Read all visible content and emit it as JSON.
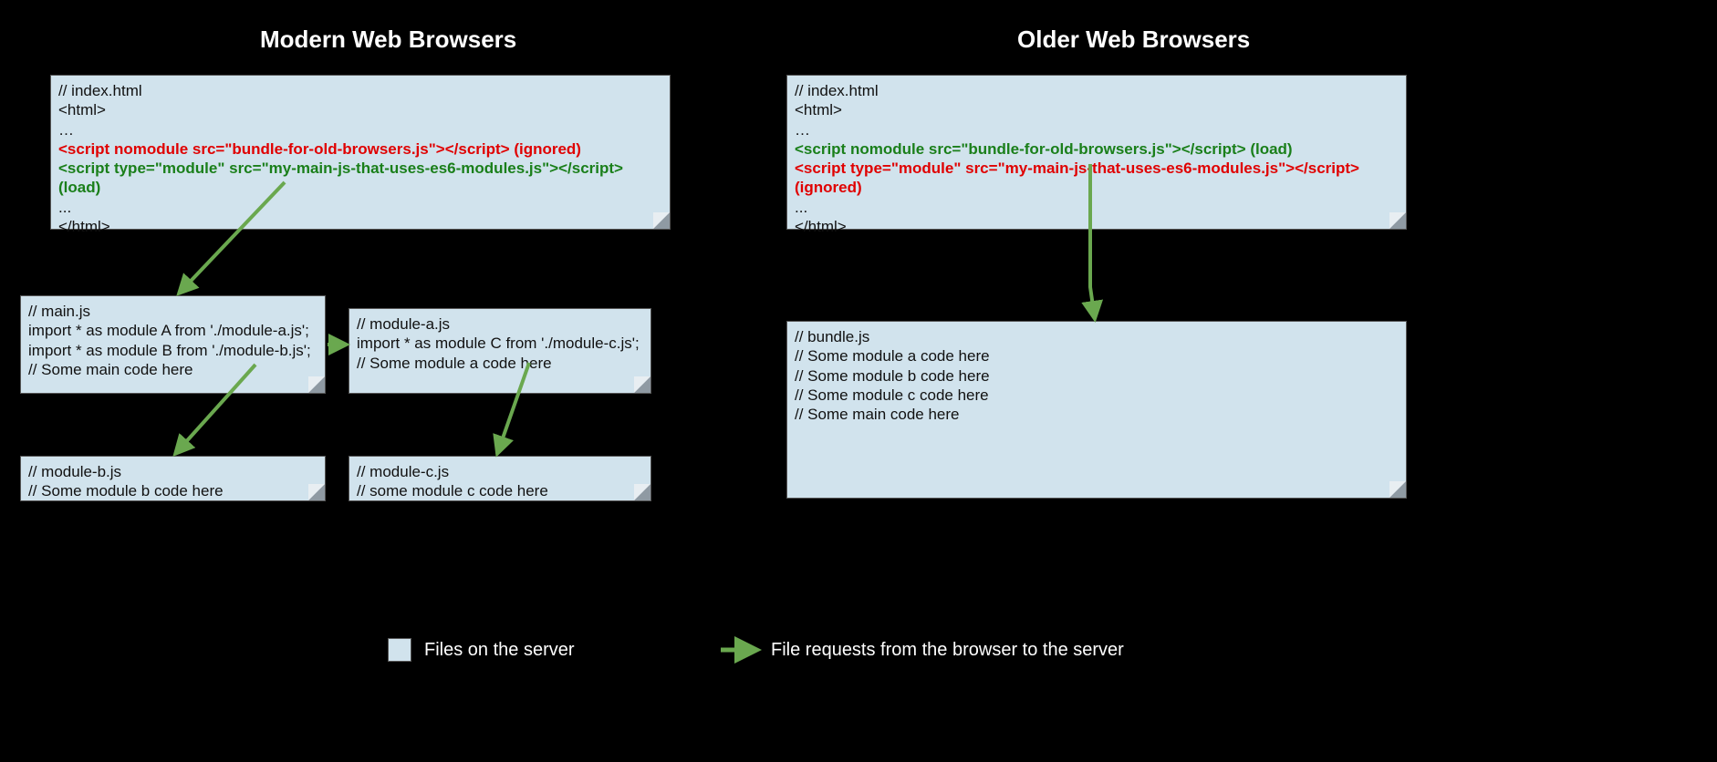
{
  "headings": {
    "left": "Modern Web Browsers",
    "right": "Older Web Browsers"
  },
  "left": {
    "index_html": {
      "l0": "// index.html",
      "l1": "",
      "l2": "<html>",
      "l3": "…",
      "nomodule": "<script nomodule src=\"bundle-for-old-browsers.js\"></script> (ignored)",
      "module": "<script type=\"module\" src=\"my-main-js-that-uses-es6-modules.js\"></script> (load)",
      "l6": "...",
      "l7": "</html>"
    },
    "main_js": {
      "l0": "// main.js",
      "l1": "",
      "l2": "import * as module A from './module-a.js';",
      "l3": "import * as module B from './module-b.js';",
      "l4": "// Some main code here"
    },
    "module_a": {
      "l0": "// module-a.js",
      "l1": "",
      "l2": "import * as module C from './module-c.js';",
      "l3": "// Some module a code here"
    },
    "module_b": {
      "l0": "// module-b.js",
      "l1": "// Some module b code here"
    },
    "module_c": {
      "l0": "// module-c.js",
      "l1": "// some module c code here"
    }
  },
  "right": {
    "index_html": {
      "l0": "// index.html",
      "l1": "",
      "l2": "<html>",
      "l3": "…",
      "nomodule": "<script nomodule src=\"bundle-for-old-browsers.js\"></script> (load)",
      "module": "<script type=\"module\" src=\"my-main-js-that-uses-es6-modules.js\"></script> (ignored)",
      "l6": "...",
      "l7": "</html>"
    },
    "bundle_js": {
      "l0": "// bundle.js",
      "l1": "",
      "l2": "",
      "l3": "// Some module a code here",
      "l4": "// Some module b code here",
      "l5": "// Some module c code here",
      "l6": "// Some main code here"
    }
  },
  "legend": {
    "files": "Files on the server",
    "requests": "File requests from the browser to the server"
  },
  "colors": {
    "note_bg": "#d1e3ed",
    "arrow": "#6aa84f",
    "red": "#e00000",
    "green": "#1a7f1a"
  }
}
